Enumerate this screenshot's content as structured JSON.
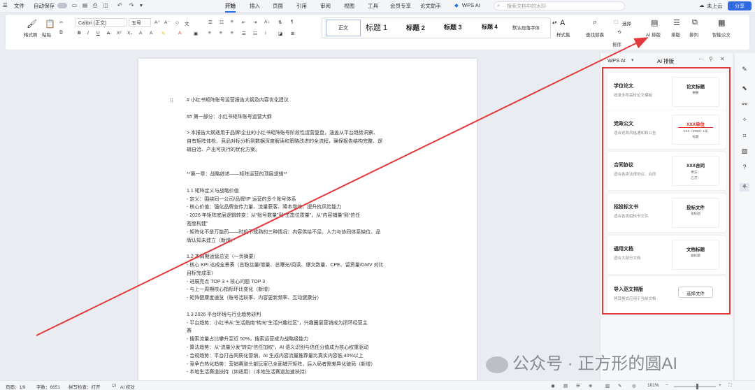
{
  "titlebar": {
    "file": "文件",
    "autosave": "自动保存",
    "tabs": [
      "开始",
      "插入",
      "页面",
      "引用",
      "审阅",
      "视图",
      "工具",
      "会员专享",
      "论文助手",
      "WPS AI"
    ],
    "search_placeholder": "搜索文档中的水印",
    "cloud": "未上云",
    "share": "分享"
  },
  "ribbon": {
    "format_painter": "格式刷",
    "paste": "粘贴",
    "font_name": "Calibri (正文)",
    "font_size": "五号",
    "styles": [
      "正文",
      "标题 1",
      "标题 2",
      "标题 3",
      "标题 4",
      "默认段落字体"
    ],
    "style_set": "样式集",
    "find_replace": "查找替换",
    "select": "选择",
    "ai_layout": "AI 排版",
    "layout": "排版",
    "arrange": "排列",
    "smart_doc": "智能公文",
    "sort": "排序"
  },
  "document": {
    "lines": [
      "# 小红书矩阵账号运营报告大纲及内容优化建议",
      "",
      "## 第一部分：小红书矩阵账号运营大纲",
      "",
      "> 本报告大纲适用于品牌/企业的小红书矩阵账号阶段性运营复盘，涵盖从平台趋势洞察、",
      "自有矩阵体检、竞品对标分析到数据深度解读和策略改进的全流程，确保报告结构完整、逻",
      "辑自洽、产出可执行的优化方案。",
      "",
      "",
      "**第一章：战略综述——矩阵运营的顶层逻辑**",
      "",
      "1.1 矩阵定义与战略价值",
      "- 定义：围绕同一公司/品牌/IP 运营的多个账号体系",
      "- 核心价值：强化品牌宣传力量、流量获客、降本增效、提升抗风险能力",
      "- 2026 年矩阵底层逻辑转变：从“账号数量”到“生态位质量”，从“内容铺量”到“信任",
      "密度构建”",
      "- 矩阵化不是万能药——时机不成熟的三种情况：内容供给不足、人力与协同体系缺位、品",
      "牌认知未建立（新增）",
      "",
      "1.2 本周期运营总览（一页摘要）",
      "- 核心 KPI 达成全景表（总粉丝量/增量、总曝光/阅读、爆文数量、CPE、留资量/GMV 对比",
      "目标完成率）",
      "- 进展亮点 TOP 3 + 核心问题 TOP 3",
      "- 与上一周期核心指标环比变化（新增）",
      "- 矩阵健康度速览（账号活跃率、内容更新频率、互动健康分）",
      "",
      "1.3 2026 平台环境与行业趋势研判",
      "- 平台趋势：小红书从“生活指南”转向“生活兴趣社区”，兴趣圈层营销成为闭环经营主",
      "赛",
      "- 搜索流量占比攀升至近 50%，搜索运营成为战略级能力",
      "- 算法趋势：从“流量分发”转向“信任加权”，AI 语义识别与信任分值成为核心权重驱动",
      "- 合规趋势：平台打击同质化营销，AI 生成内容流量推荐量比真实内容低 40%以上",
      "- 竞争白热化趋势：营销赛道头部玩家已全面铺开矩阵，后入局者需差异化破局（新增）",
      "- 本地生活赛道扶持（如适用）（本地生活赛道加速扶持）"
    ]
  },
  "panel": {
    "tab_ai": "WPS AI",
    "tab_layout": "AI 排版",
    "cards": [
      {
        "title": "学位论文",
        "desc": "收录多所高校论文模板",
        "thumb_title": "论文标题",
        "thumb_sub": "摘要"
      },
      {
        "title": "党政公文",
        "desc": "适合党政风格通知和公告",
        "thumb_title": "XXX单位",
        "thumb_sub": "XXX〔2023〕1号",
        "thumb_sub2": "标题"
      },
      {
        "title": "合同协议",
        "desc": "适合各类法律协议、合同",
        "thumb_title": "XXX合同",
        "thumb_sub": "甲方：",
        "thumb_sub2": "乙方："
      },
      {
        "title": "招投标文书",
        "desc": "适合各类招标书文件",
        "thumb_title": "投标文件",
        "thumb_sub": "投标函"
      },
      {
        "title": "通用文档",
        "desc": "适合大部分文档",
        "thumb_title": "文档标题",
        "thumb_sub": "副标题"
      },
      {
        "title": "导入范文排版",
        "desc": "将其格式应用于当前文档",
        "button": "选择文件"
      }
    ]
  },
  "statusbar": {
    "page": "页面：1/9",
    "words": "字数：6651",
    "spell": "拼写检查：打开",
    "ai_check": "AI 校对",
    "zoom": "101%"
  },
  "watermark": "公众号 · 正方形的圆AI",
  "colors": {
    "accent": "#2f6ae1",
    "highlight_box": "#e4393c",
    "arrow": "#e4393c"
  }
}
